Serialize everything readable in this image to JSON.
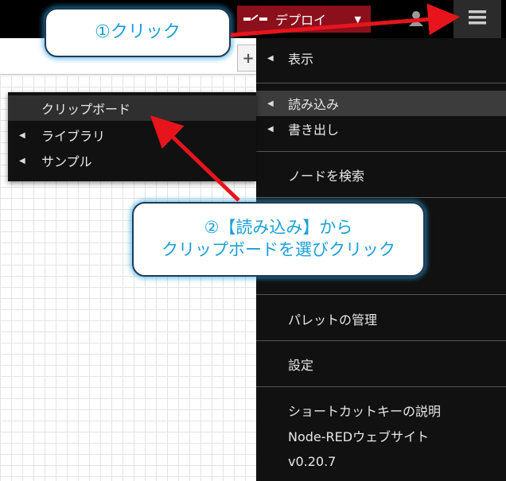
{
  "header": {
    "deploy_label": "デプロイ"
  },
  "main_menu": {
    "view": "表示",
    "import": "読み込み",
    "export": "書き出し",
    "search": "ノードを検索",
    "manage_palette": "パレットの管理",
    "settings": "設定",
    "shortcuts": "ショートカットキーの説明",
    "website": "Node-REDウェブサイト",
    "version": "v0.20.7"
  },
  "import_submenu": {
    "clipboard": "クリップボード",
    "library": "ライブラリ",
    "examples": "サンプル"
  },
  "callouts": {
    "step1": "①クリック",
    "step2_line1": "②【読み込み】から",
    "step2_line2": "クリップボードを選びクリック"
  },
  "colors": {
    "deploy_bg": "#8c101c",
    "arrow": "#e8141c",
    "callout_text": "#1aa0d8"
  }
}
